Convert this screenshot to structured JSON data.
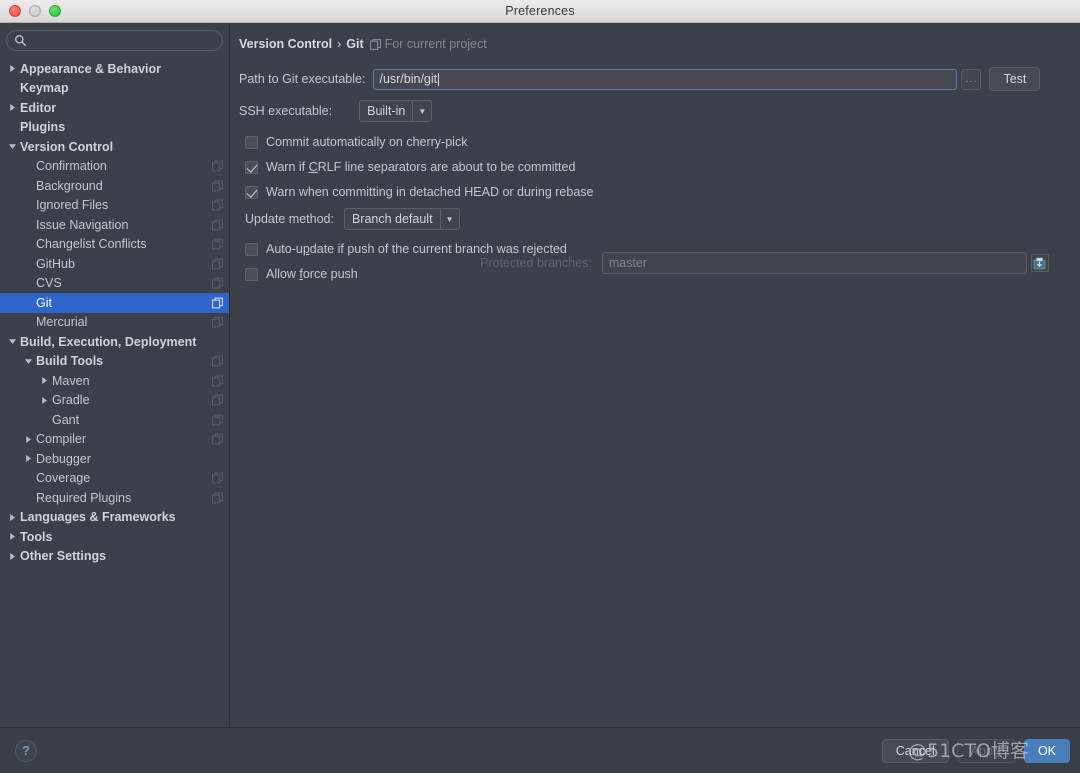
{
  "window": {
    "title": "Preferences",
    "traffic_lights": [
      "close-button",
      "minimize-button",
      "zoom-button"
    ]
  },
  "sidebar": {
    "search": {
      "value": "",
      "placeholder": ""
    },
    "items": [
      {
        "label": "Appearance & Behavior",
        "depth": 0,
        "twisty": "collapsed",
        "bold": true,
        "scope": false,
        "selected": false
      },
      {
        "label": "Keymap",
        "depth": 0,
        "twisty": "none",
        "bold": true,
        "scope": false,
        "selected": false
      },
      {
        "label": "Editor",
        "depth": 0,
        "twisty": "collapsed",
        "bold": true,
        "scope": false,
        "selected": false
      },
      {
        "label": "Plugins",
        "depth": 0,
        "twisty": "none",
        "bold": true,
        "scope": false,
        "selected": false
      },
      {
        "label": "Version Control",
        "depth": 0,
        "twisty": "expanded",
        "bold": true,
        "scope": false,
        "selected": false
      },
      {
        "label": "Confirmation",
        "depth": 1,
        "twisty": "none",
        "bold": false,
        "scope": true,
        "selected": false
      },
      {
        "label": "Background",
        "depth": 1,
        "twisty": "none",
        "bold": false,
        "scope": true,
        "selected": false
      },
      {
        "label": "Ignored Files",
        "depth": 1,
        "twisty": "none",
        "bold": false,
        "scope": true,
        "selected": false
      },
      {
        "label": "Issue Navigation",
        "depth": 1,
        "twisty": "none",
        "bold": false,
        "scope": true,
        "selected": false
      },
      {
        "label": "Changelist Conflicts",
        "depth": 1,
        "twisty": "none",
        "bold": false,
        "scope": true,
        "selected": false
      },
      {
        "label": "GitHub",
        "depth": 1,
        "twisty": "none",
        "bold": false,
        "scope": true,
        "selected": false
      },
      {
        "label": "CVS",
        "depth": 1,
        "twisty": "none",
        "bold": false,
        "scope": true,
        "selected": false
      },
      {
        "label": "Git",
        "depth": 1,
        "twisty": "none",
        "bold": false,
        "scope": true,
        "selected": true
      },
      {
        "label": "Mercurial",
        "depth": 1,
        "twisty": "none",
        "bold": false,
        "scope": true,
        "selected": false
      },
      {
        "label": "Build, Execution, Deployment",
        "depth": 0,
        "twisty": "expanded",
        "bold": true,
        "scope": false,
        "selected": false
      },
      {
        "label": "Build Tools",
        "depth": 1,
        "twisty": "expanded",
        "bold": true,
        "scope": true,
        "selected": false
      },
      {
        "label": "Maven",
        "depth": 2,
        "twisty": "collapsed",
        "bold": false,
        "scope": true,
        "selected": false
      },
      {
        "label": "Gradle",
        "depth": 2,
        "twisty": "collapsed",
        "bold": false,
        "scope": true,
        "selected": false
      },
      {
        "label": "Gant",
        "depth": 2,
        "twisty": "none",
        "bold": false,
        "scope": true,
        "selected": false
      },
      {
        "label": "Compiler",
        "depth": 1,
        "twisty": "collapsed",
        "bold": false,
        "scope": true,
        "selected": false
      },
      {
        "label": "Debugger",
        "depth": 1,
        "twisty": "collapsed",
        "bold": false,
        "scope": false,
        "selected": false
      },
      {
        "label": "Coverage",
        "depth": 1,
        "twisty": "none",
        "bold": false,
        "scope": true,
        "selected": false
      },
      {
        "label": "Required Plugins",
        "depth": 1,
        "twisty": "none",
        "bold": false,
        "scope": true,
        "selected": false
      },
      {
        "label": "Languages & Frameworks",
        "depth": 0,
        "twisty": "collapsed",
        "bold": true,
        "scope": false,
        "selected": false
      },
      {
        "label": "Tools",
        "depth": 0,
        "twisty": "collapsed",
        "bold": true,
        "scope": false,
        "selected": false
      },
      {
        "label": "Other Settings",
        "depth": 0,
        "twisty": "collapsed",
        "bold": true,
        "scope": false,
        "selected": false
      }
    ]
  },
  "main": {
    "breadcrumb": {
      "root": "Version Control",
      "separator": "›",
      "current": "Git",
      "scope_note": "For current project"
    },
    "path_row": {
      "label": "Path to Git executable:",
      "value": "/usr/bin/git",
      "browse_label": "...",
      "test_label": "Test"
    },
    "ssh_row": {
      "label": "SSH executable:",
      "value": "Built-in"
    },
    "checkboxes": [
      {
        "label": "Commit automatically on cherry-pick",
        "checked": false,
        "mnemonic": ""
      },
      {
        "label": "Warn if CRLF line separators are about to be committed",
        "checked": true,
        "mnemonic": "C"
      },
      {
        "label": "Warn when committing in detached HEAD or during rebase",
        "checked": true,
        "mnemonic": ""
      }
    ],
    "update_row": {
      "label": "Update method:",
      "value": "Branch default"
    },
    "checkboxes2": [
      {
        "label": "Auto-update if push of the current branch was rejected",
        "checked": false,
        "mnemonic": "p"
      },
      {
        "label": "Allow force push",
        "checked": false,
        "mnemonic": "f"
      }
    ],
    "protected": {
      "label": "Protected branches:",
      "value": "master",
      "edit_icon": "edit-list-icon"
    }
  },
  "footer": {
    "help_label": "?",
    "cancel_label": "Cancel",
    "apply_label": "Apply",
    "ok_label": "OK"
  },
  "watermark": {
    "text": "@51CTO博客"
  },
  "colors": {
    "window_bg": "#3c4048",
    "titlebar_bg": "#eceaea",
    "selection_blue": "#2f65ca",
    "default_button_blue": "#4a7ebb",
    "focus_border": "#5a7fb4",
    "text_primary": "#c3c7ce",
    "text_dim": "#7d828a"
  }
}
